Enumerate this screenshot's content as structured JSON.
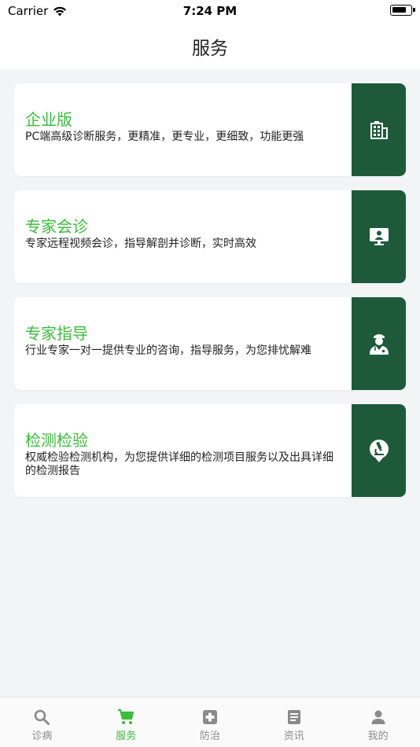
{
  "status": {
    "carrier": "Carrier",
    "time": "7:24 PM"
  },
  "header": {
    "title": "服务"
  },
  "cards": [
    {
      "title": "企业版",
      "desc": "PC端高级诊断服务，更精准，更专业，更细致，功能更强"
    },
    {
      "title": "专家会诊",
      "desc": "专家远程视频会诊，指导解剖并诊断，实时高效"
    },
    {
      "title": "专家指导",
      "desc": "行业专家一对一提供专业的咨询，指导服务，为您排忧解难"
    },
    {
      "title": "检测检验",
      "desc": "权威检验检测机构，为您提供详细的检测项目服务以及出具详细的检测报告"
    }
  ],
  "tabs": [
    {
      "label": "诊病",
      "icon": "search-icon"
    },
    {
      "label": "服务",
      "icon": "cart-icon"
    },
    {
      "label": "防治",
      "icon": "medical-cross-icon"
    },
    {
      "label": "资讯",
      "icon": "document-icon"
    },
    {
      "label": "我的",
      "icon": "person-icon"
    }
  ],
  "colors": {
    "accent": "#3dbb3d",
    "card_icon_bg": "#1e5a3a",
    "tab_inactive": "#8a8a8a"
  }
}
